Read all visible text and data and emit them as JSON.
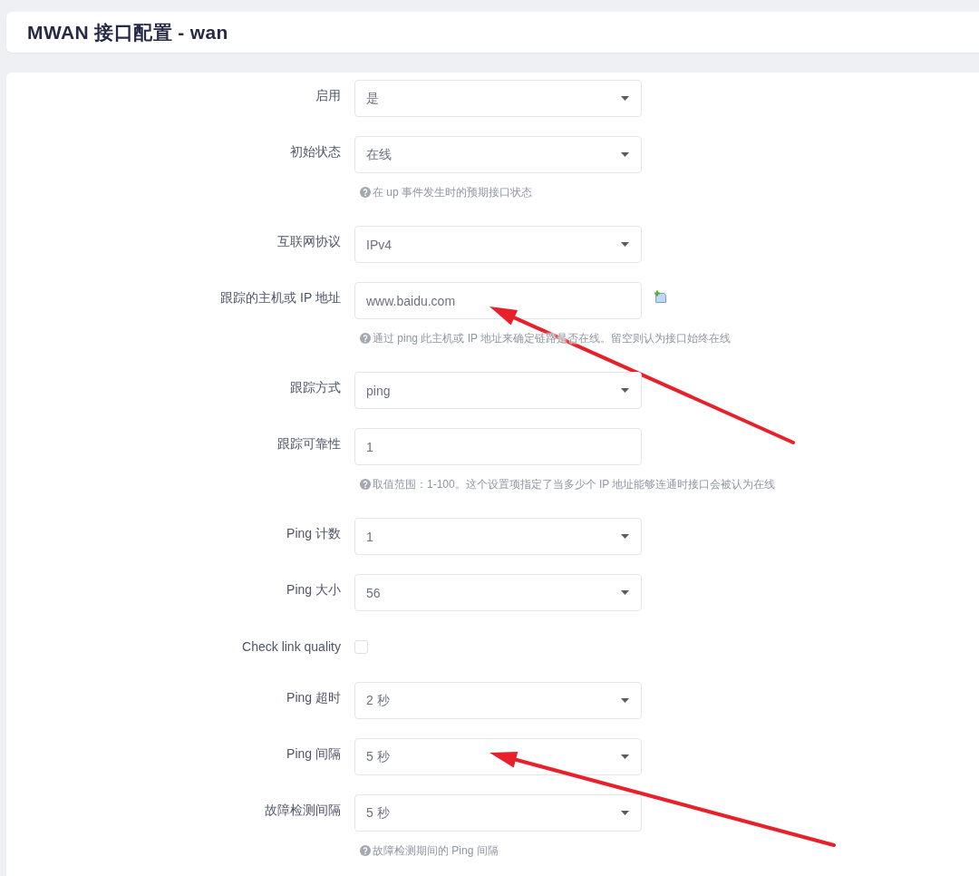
{
  "title": "MWAN 接口配置 - wan",
  "fields": [
    {
      "kind": "select",
      "label": "启用",
      "value": "是",
      "arrow": false
    },
    {
      "kind": "select",
      "label": "初始状态",
      "value": "在线",
      "help": "在 up 事件发生时的预期接口状态",
      "arrow": false
    },
    {
      "kind": "select",
      "label": "互联网协议",
      "value": "IPv4",
      "arrow": false
    },
    {
      "kind": "dynlist",
      "label": "跟踪的主机或 IP 地址",
      "value": "www.baidu.com",
      "help": "通过 ping 此主机或 IP 地址来确定链路是否在线。留空则认为接口始终在线",
      "arrow": true
    },
    {
      "kind": "select",
      "label": "跟踪方式",
      "value": "ping",
      "arrow": false
    },
    {
      "kind": "text",
      "label": "跟踪可靠性",
      "value": "1",
      "help": "取值范围：1-100。这个设置项指定了当多少个 IP 地址能够连通时接口会被认为在线",
      "arrow": false
    },
    {
      "kind": "select",
      "label": "Ping 计数",
      "value": "1",
      "arrow": false
    },
    {
      "kind": "select",
      "label": "Ping 大小",
      "value": "56",
      "arrow": false
    },
    {
      "kind": "checkbox",
      "label": "Check link quality",
      "checked": false,
      "arrow": false
    },
    {
      "kind": "select",
      "label": "Ping 超时",
      "value": "2 秒",
      "arrow": false
    },
    {
      "kind": "select",
      "label": "Ping 间隔",
      "value": "5 秒",
      "arrow": true
    },
    {
      "kind": "select",
      "label": "故障检测间隔",
      "value": "5 秒",
      "help": "故障检测期间的 Ping 间隔",
      "arrow": false
    }
  ]
}
